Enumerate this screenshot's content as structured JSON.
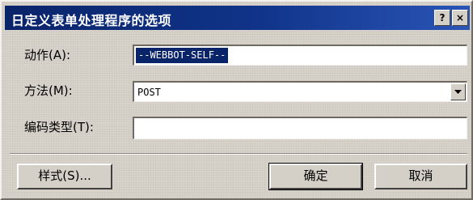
{
  "dialog": {
    "title": "日定义表单处理程序的选项",
    "help_button": "?",
    "close_button": "×"
  },
  "fields": {
    "action_label": "动作(A):",
    "action_value": "--WEBBOT-SELF--",
    "method_label": "方法(M):",
    "method_value": "POST",
    "encoding_label": "编码类型(T):",
    "encoding_value": ""
  },
  "buttons": {
    "style": "样式(S)...",
    "ok": "确定",
    "cancel": "取消"
  },
  "colors": {
    "titlebar": "#0a246a",
    "dialog_face": "#d7d3ca",
    "selection": "#0a246a"
  }
}
